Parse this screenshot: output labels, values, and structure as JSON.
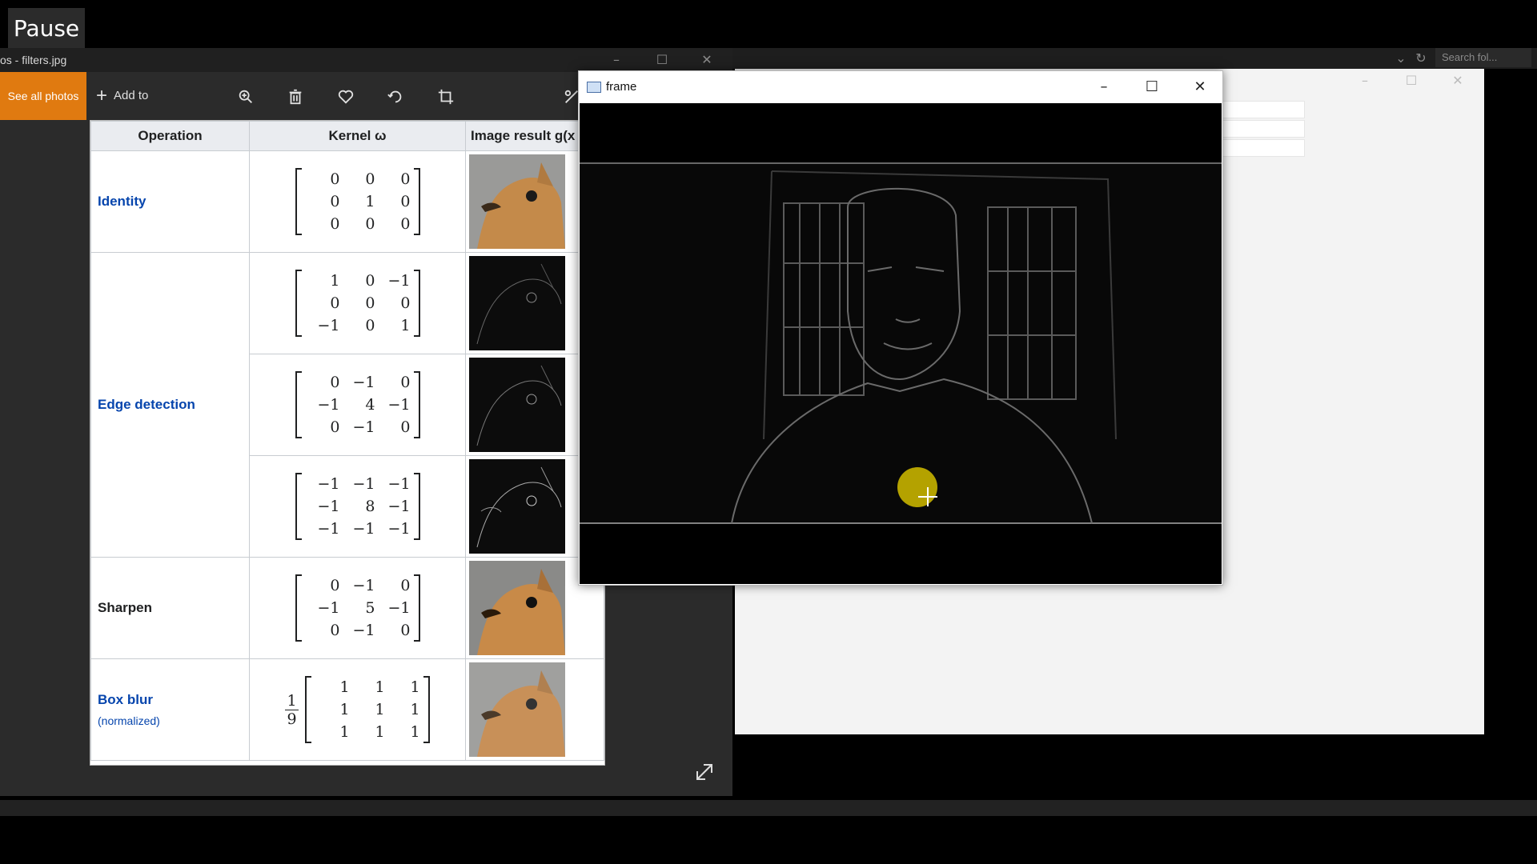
{
  "overlay": {
    "pause_label": "Pause"
  },
  "photos": {
    "title": "os - filters.jpg",
    "see_all": "See all photos",
    "add_to": "Add to",
    "toolbar_icons": [
      "zoom-in-icon",
      "delete-icon",
      "heart-icon",
      "rotate-icon",
      "crop-icon",
      "edit-icon"
    ],
    "accent": "#e07a10"
  },
  "filters_table": {
    "headers": {
      "operation": "Operation",
      "kernel": "Kernel ω",
      "result": "Image result g(x"
    },
    "rows": {
      "identity": {
        "label": "Identity",
        "kernel": [
          [
            "0",
            "0",
            "0"
          ],
          [
            "0",
            "1",
            "0"
          ],
          [
            "0",
            "0",
            "0"
          ]
        ]
      },
      "edge": {
        "label": "Edge detection",
        "k1": [
          [
            "1",
            "0",
            "−1"
          ],
          [
            "0",
            "0",
            "0"
          ],
          [
            "−1",
            "0",
            "1"
          ]
        ],
        "k2": [
          [
            "0",
            "−1",
            "0"
          ],
          [
            "−1",
            "4",
            "−1"
          ],
          [
            "0",
            "−1",
            "0"
          ]
        ],
        "k3": [
          [
            "−1",
            "−1",
            "−1"
          ],
          [
            "−1",
            "8",
            "−1"
          ],
          [
            "−1",
            "−1",
            "−1"
          ]
        ]
      },
      "sharpen": {
        "label": "Sharpen",
        "kernel": [
          [
            "0",
            "−1",
            "0"
          ],
          [
            "−1",
            "5",
            "−1"
          ],
          [
            "0",
            "−1",
            "0"
          ]
        ]
      },
      "boxblur": {
        "label": "Box blur",
        "sublabel": "(normalized)",
        "frac_num": "1",
        "frac_den": "9",
        "kernel": [
          [
            "1",
            "1",
            "1"
          ],
          [
            "1",
            "1",
            "1"
          ],
          [
            "1",
            "1",
            "1"
          ]
        ]
      }
    }
  },
  "explorer": {
    "search_placeholder": "Search fol..."
  },
  "frame_window": {
    "title": "frame"
  }
}
